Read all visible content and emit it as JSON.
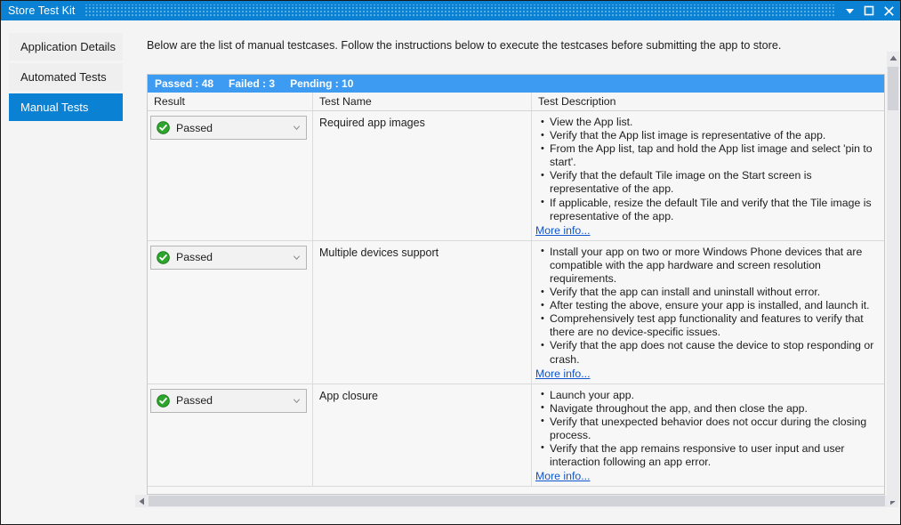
{
  "window": {
    "title": "Store Test Kit",
    "controls": [
      {
        "name": "minimize-dropdown-button",
        "icon": "chevron-down-icon"
      },
      {
        "name": "maximize-button",
        "icon": "maximize-icon"
      },
      {
        "name": "close-button",
        "icon": "close-icon"
      }
    ]
  },
  "colors": {
    "titlebar": "#0b81d3",
    "accent": "#0b81d3",
    "status_bar": "#3e9bf2",
    "pass_green": "#2da52d",
    "link": "#1155cc"
  },
  "sidebar": {
    "items": [
      {
        "label": "Application Details",
        "selected": false
      },
      {
        "label": "Automated Tests",
        "selected": false
      },
      {
        "label": "Manual Tests",
        "selected": true
      }
    ]
  },
  "main": {
    "instructions": "Below are the list of manual testcases. Follow the instructions below to execute the testcases before submitting the app to store.",
    "status": {
      "passed_label": "Passed : 48",
      "failed_label": "Failed : 3",
      "pending_label": "Pending : 10",
      "passed_count": 48,
      "failed_count": 3,
      "pending_count": 10
    },
    "grid": {
      "columns": [
        "Result",
        "Test Name",
        "Test Description"
      ],
      "rows": [
        {
          "result": "Passed",
          "result_icon": "check-circle-icon",
          "name": "Required app images",
          "bullets": [
            "View the App list.",
            "Verify that the App list image is representative of the app.",
            "From the App list, tap and hold the App list image and select 'pin to start'.",
            "Verify that the default Tile image on the Start screen is representative of the app.",
            "If applicable, resize the default Tile and verify that the Tile image is representative of the app."
          ],
          "more_link": "More info..."
        },
        {
          "result": "Passed",
          "result_icon": "check-circle-icon",
          "name": "Multiple devices support",
          "bullets": [
            "Install your app on two or more Windows Phone devices that are compatible with the app hardware and screen resolution requirements.",
            "Verify that the app can install and uninstall without error.",
            "After testing the above, ensure your app is installed, and launch it.",
            "Comprehensively test app functionality and features to verify that there are no device-specific issues.",
            "Verify that the app does not cause the device to stop responding or crash."
          ],
          "more_link": "More info..."
        },
        {
          "result": "Passed",
          "result_icon": "check-circle-icon",
          "name": "App closure",
          "bullets": [
            "Launch your app.",
            "Navigate throughout the app, and then close the app.",
            "Verify that unexpected behavior does not occur during the closing process.",
            "Verify that the app remains responsive to user input and user interaction following an app error."
          ],
          "more_link": "More info..."
        }
      ]
    }
  }
}
